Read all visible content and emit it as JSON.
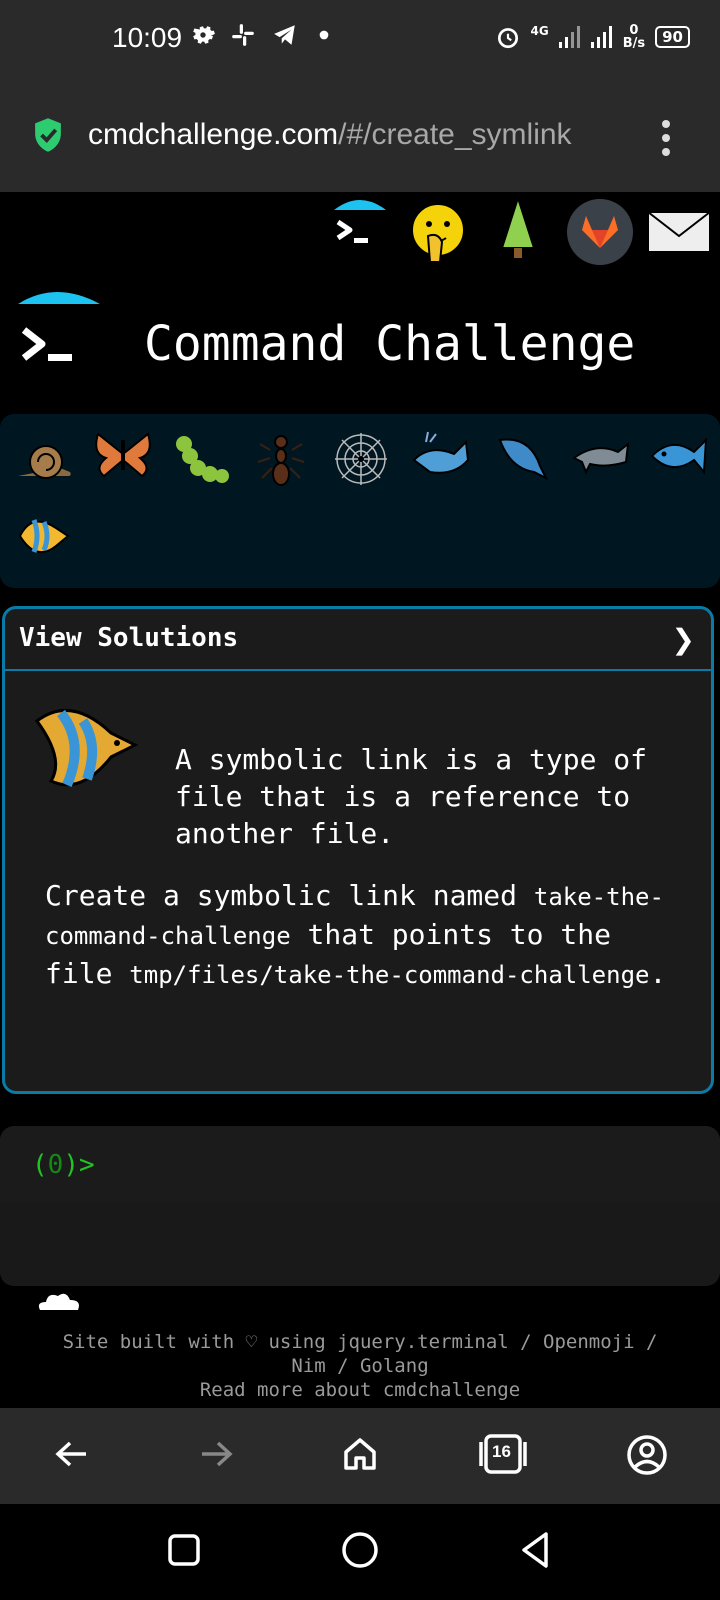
{
  "status_bar": {
    "time": "10:09",
    "network": "4G",
    "data_rate_top": "0",
    "data_rate_unit": "B/s",
    "battery": "90",
    "left_icons": [
      "gear-icon",
      "slack-icon",
      "telegram-icon",
      "dot-icon"
    ],
    "right_icons": [
      "alarm-icon",
      "signal-icon",
      "signal-icon"
    ]
  },
  "url_bar": {
    "domain": "cmdchallenge.com",
    "path": "/#/create_symlink",
    "secure_color": "#2ecc71"
  },
  "header_icons": [
    "terminal-icon",
    "shush-face-icon",
    "tree-icon",
    "gitlab-icon",
    "mail-icon"
  ],
  "site": {
    "title": "Command Challenge"
  },
  "levels": {
    "icons": [
      "snail-icon",
      "butterfly-icon",
      "caterpillar-icon",
      "ant-icon",
      "spiderweb-icon",
      "whale-icon",
      "spouting-whale-icon",
      "dolphin-icon",
      "fish-icon",
      "tropical-fish-icon"
    ]
  },
  "solutions": {
    "header_label": "View Solutions",
    "chevron": "❯",
    "lead": "A symbolic link is a type of file that is a reference to another file.",
    "task_prefix": "Create a symbolic link named ",
    "task_code1": "take-the-command-challenge",
    "task_mid": " that points to the file ",
    "task_code2": "tmp/files/take-the-command-challenge",
    "task_suffix": "."
  },
  "terminal": {
    "prompt_open": "(",
    "prompt_num": "0",
    "prompt_close": ")>"
  },
  "footer": {
    "line1": "Site built with ♡ using jquery.terminal / Openmoji /",
    "line2": "Nim / Golang",
    "line3": "Read more about cmdchallenge"
  },
  "browser_nav": {
    "tab_count": "16",
    "icons": [
      "back-icon",
      "forward-icon",
      "home-icon",
      "tabs-icon",
      "account-icon"
    ]
  },
  "system_nav": {
    "icons": [
      "recents-icon",
      "home-circle-icon",
      "back-triangle-icon"
    ]
  },
  "colors": {
    "accent": "#0a7aa6",
    "prompt_green": "#22c322",
    "level_bg": "#001722"
  }
}
